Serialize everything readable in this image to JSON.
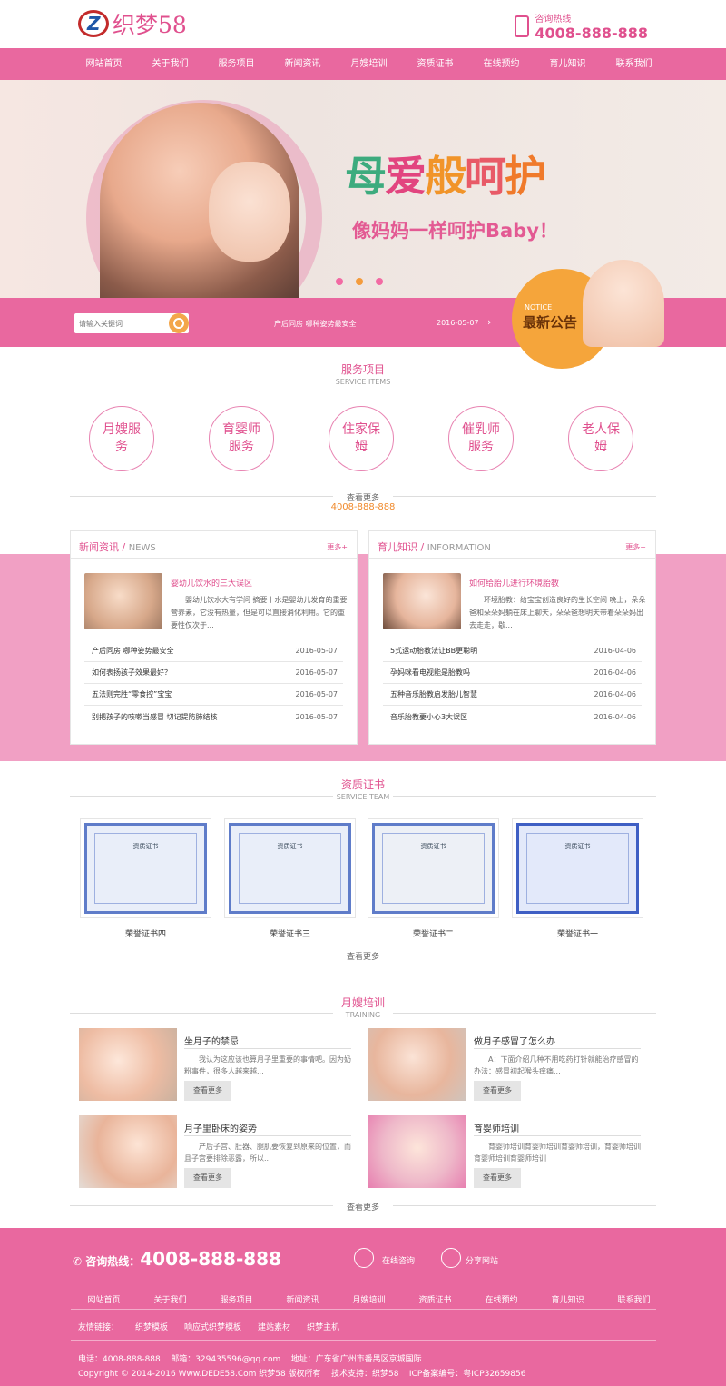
{
  "header": {
    "logo_text": "织梦58",
    "hotline_label": "咨询热线",
    "hotline_number": "4008-888-888"
  },
  "nav": [
    "网站首页",
    "关于我们",
    "服务项目",
    "新闻资讯",
    "月嫂培训",
    "资质证书",
    "在线预约",
    "育儿知识",
    "联系我们"
  ],
  "banner": {
    "slogan_main": "母爱般呵护",
    "slogan_sub": "像妈妈一样呵护Baby！",
    "colors": {
      "mu": "#3dab7e",
      "ai": "#e2457f",
      "ban": "#f19429",
      "he": "#e85a67",
      "hu": "#f07a2b"
    }
  },
  "notice_bar": {
    "search_placeholder": "请输入关键词",
    "title": "产后同房 哪种姿势最安全",
    "date": "2016-05-07",
    "arrow": "›",
    "badge_small": "NOTICE",
    "badge_big": "最新公告"
  },
  "services": {
    "title": "服务项目",
    "subtitle": "SERVICE ITEMS",
    "items": [
      [
        "月嫂服",
        "务"
      ],
      [
        "育婴师",
        "服务"
      ],
      [
        "住家保",
        "姆"
      ],
      [
        "催乳师",
        "服务"
      ],
      [
        "老人保",
        "姆"
      ]
    ],
    "more": "查看更多",
    "tel": "4008-888-888"
  },
  "news": {
    "title": "新闻资讯",
    "title_en": "NEWS",
    "more": "更多+",
    "featured": {
      "title": "婴幼儿饮水的三大误区",
      "desc": "婴幼儿饮水大有学问 摘要丨水是婴幼儿发育的重要营养素，它没有热量，但是可以直接消化利用。它的重要性仅次于..."
    },
    "items": [
      {
        "title": "产后同房 哪种姿势最安全",
        "date": "2016-05-07"
      },
      {
        "title": "如何表扬孩子效果最好？",
        "date": "2016-05-07"
      },
      {
        "title": "五法则完胜“零食控”宝宝",
        "date": "2016-05-07"
      },
      {
        "title": "别把孩子的咳嗽当感冒 切记提防肺结核",
        "date": "2016-05-07"
      }
    ]
  },
  "info": {
    "title": "育儿知识",
    "title_en": "INFORMATION",
    "more": "更多+",
    "featured": {
      "title": "如何给胎儿进行环境胎教",
      "desc": "环境胎教：给宝宝创造良好的生长空间 晚上，朵朵爸和朵朵妈躺在床上聊天，朵朵爸想明天带着朵朵妈出去走走，歇..."
    },
    "items": [
      {
        "title": "5式运动胎教法让BB更聪明",
        "date": "2016-04-06"
      },
      {
        "title": "孕妈咪看电视能是胎教吗",
        "date": "2016-04-06"
      },
      {
        "title": "五种音乐胎教启发胎儿智慧",
        "date": "2016-04-06"
      },
      {
        "title": "音乐胎教要小心3大误区",
        "date": "2016-04-06"
      }
    ]
  },
  "certs": {
    "title": "资质证书",
    "subtitle": "SERVICE TEAM",
    "items": [
      "荣誉证书四",
      "荣誉证书三",
      "荣誉证书二",
      "荣誉证书一"
    ],
    "cert_header": "资质证书",
    "more": "查看更多"
  },
  "training": {
    "title": "月嫂培训",
    "subtitle": "TRAINING",
    "btn": "查看更多",
    "more": "查看更多",
    "items": [
      {
        "title": "坐月子的禁忌",
        "desc": "我认为这应该也算月子里重要的事情吧。因为奶粉事件，很多人越来越..."
      },
      {
        "title": "做月子感冒了怎么办",
        "desc": "A：下面介绍几种不用吃药打针就能治疗感冒的办法：感冒初起喉头痒痛..."
      },
      {
        "title": "月子里卧床的姿势",
        "desc": "产后子宫、肚器、腿肌要恢复到原来的位置，而且子宫要排除恶露，所以..."
      },
      {
        "title": "育婴师培训",
        "desc": "育婴师培训育婴师培训育婴师培训，育婴师培训育婴师培训育婴师培训"
      }
    ]
  },
  "footer": {
    "hotline_label": "咨询热线：",
    "hotline_number": "4008-888-888",
    "online": "在线咨询",
    "share": "分享网站",
    "nav": [
      "网站首页",
      "关于我们",
      "服务项目",
      "新闻资讯",
      "月嫂培训",
      "资质证书",
      "在线预约",
      "育儿知识",
      "联系我们"
    ],
    "links_label": "友情链接：",
    "links": [
      "织梦模板",
      "响应式织梦模板",
      "建站素材",
      "织梦主机"
    ],
    "contact": "电话：4008-888-888    邮箱：329435596@qq.com    地址：广东省广州市番禺区京城国际",
    "copyright": "Copyright © 2014-2016 Www.DEDE58.Com 织梦58 版权所有    技术支持：织梦58    ICP备案编号：粤ICP32659856"
  }
}
